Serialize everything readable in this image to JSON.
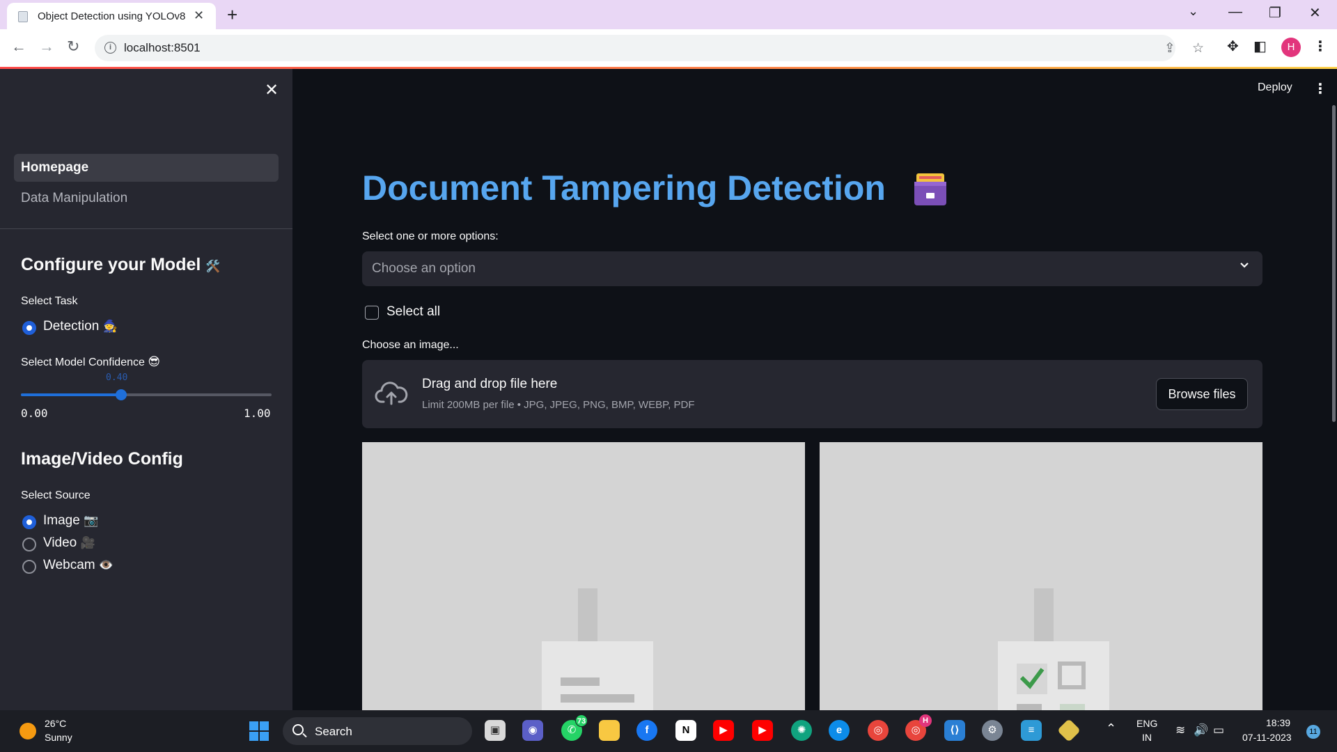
{
  "browser": {
    "tab_title": "Object Detection using YOLOv8",
    "url": "localhost:8501",
    "profile_initial": "H"
  },
  "header": {
    "deploy_label": "Deploy"
  },
  "sidebar": {
    "nav": [
      {
        "label": "Homepage",
        "active": true
      },
      {
        "label": "Data Manipulation",
        "active": false
      }
    ],
    "model_section_title": "Configure your Model",
    "model_section_icon": "hammer-wrench-emoji",
    "task_label": "Select Task",
    "task_options": [
      {
        "label": "Detection",
        "selected": true,
        "icon": "mage-emoji"
      }
    ],
    "confidence_label": "Select Model Confidence",
    "confidence_icon": "sunglasses-emoji",
    "confidence_value": "0.40",
    "confidence_min": "0.00",
    "confidence_max": "1.00",
    "confidence_fraction": 0.4,
    "source_section_title": "Image/Video Config",
    "source_label": "Select Source",
    "source_options": [
      {
        "label": "Image",
        "selected": true,
        "icon": "camera-emoji"
      },
      {
        "label": "Video",
        "selected": false,
        "icon": "video-camera-emoji"
      },
      {
        "label": "Webcam",
        "selected": false,
        "icon": "eye-emoji"
      }
    ]
  },
  "main": {
    "title": "Document Tampering Detection",
    "title_icon": "card-file-box-emoji",
    "multiselect_label": "Select one or more options:",
    "multiselect_placeholder": "Choose an option",
    "select_all_label": "Select all",
    "uploader_label": "Choose an image...",
    "uploader_title": "Drag and drop file here",
    "uploader_limits": "Limit 200MB per file • JPG, JPEG, PNG, BMP, WEBP, PDF",
    "browse_label": "Browse files"
  },
  "taskbar": {
    "weather_temp": "26°C",
    "weather_desc": "Sunny",
    "search_label": "Search",
    "whatsapp_badge": "73",
    "chrome_badge": "H",
    "language": "ENG",
    "region": "IN",
    "time": "18:39",
    "date": "07-11-2023",
    "notification_count": "11"
  },
  "colors": {
    "title": "#57a6ef",
    "accent": "#1f6fd9",
    "sidebar_bg": "#262730",
    "main_bg": "#0e1117"
  }
}
